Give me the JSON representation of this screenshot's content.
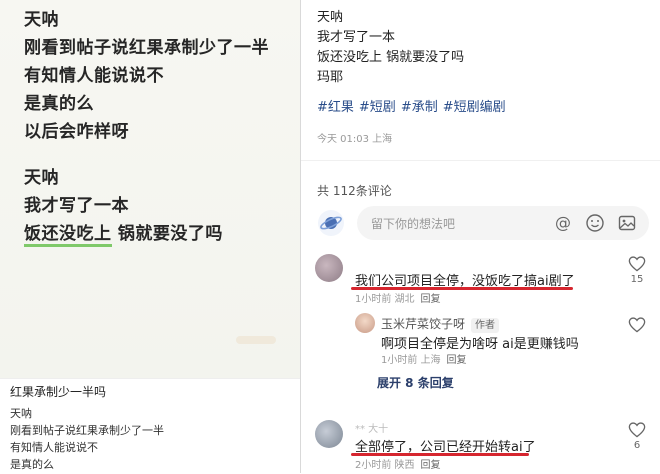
{
  "left_post": {
    "big_lines_a": [
      "天呐",
      "刚看到帖子说红果承制少了一半",
      "有知情人能说说不",
      "是真的么",
      "以后会咋样呀"
    ],
    "big_lines_b": [
      "天呐",
      "我才写了一本"
    ],
    "highlight_text": "饭还没吃上",
    "after_highlight": " 锅就要没了吗"
  },
  "left_preview": {
    "title": "红果承制少一半吗",
    "lines": [
      "天呐",
      "刚看到帖子说红果承制少了一半",
      "有知情人能说说不",
      "是真的么"
    ]
  },
  "right_post": {
    "lines": [
      "天呐",
      "我才写了一本",
      "饭还没吃上 锅就要没了吗",
      "玛耶"
    ],
    "tags": [
      "#红果",
      "#短剧",
      "#承制",
      "#短剧编剧"
    ],
    "time_location": "今天 01:03 上海",
    "comment_count": "共 112条评论"
  },
  "comment_input": {
    "placeholder": "留下你的想法吧"
  },
  "comments": [
    {
      "text": "我们公司项目全停，没饭吃了搞ai剧了",
      "time_location": "1小时前  湖北",
      "reply_label": "回复",
      "likes": "15"
    },
    {
      "masked_name": "**  大十",
      "text": "全部停了，公司已经开始转ai了",
      "time_location": "2小时前  陕西",
      "reply_label": "回复",
      "likes": "6"
    }
  ],
  "reply": {
    "name": "玉米芹菜饺子呀",
    "badge": "作者",
    "text": "啊项目全停是为啥呀 ai是更赚钱吗",
    "time_location": "1小时前  上海",
    "reply_label": "回复"
  },
  "expand_label": "展开 8 条回复",
  "colors": {
    "tag": "#2a4d8a",
    "underline_red": "#d6262f",
    "highlight_green": "#7fc96a"
  },
  "icons": [
    "planet-icon",
    "at-icon",
    "smile-icon",
    "image-icon",
    "heart-icon"
  ]
}
